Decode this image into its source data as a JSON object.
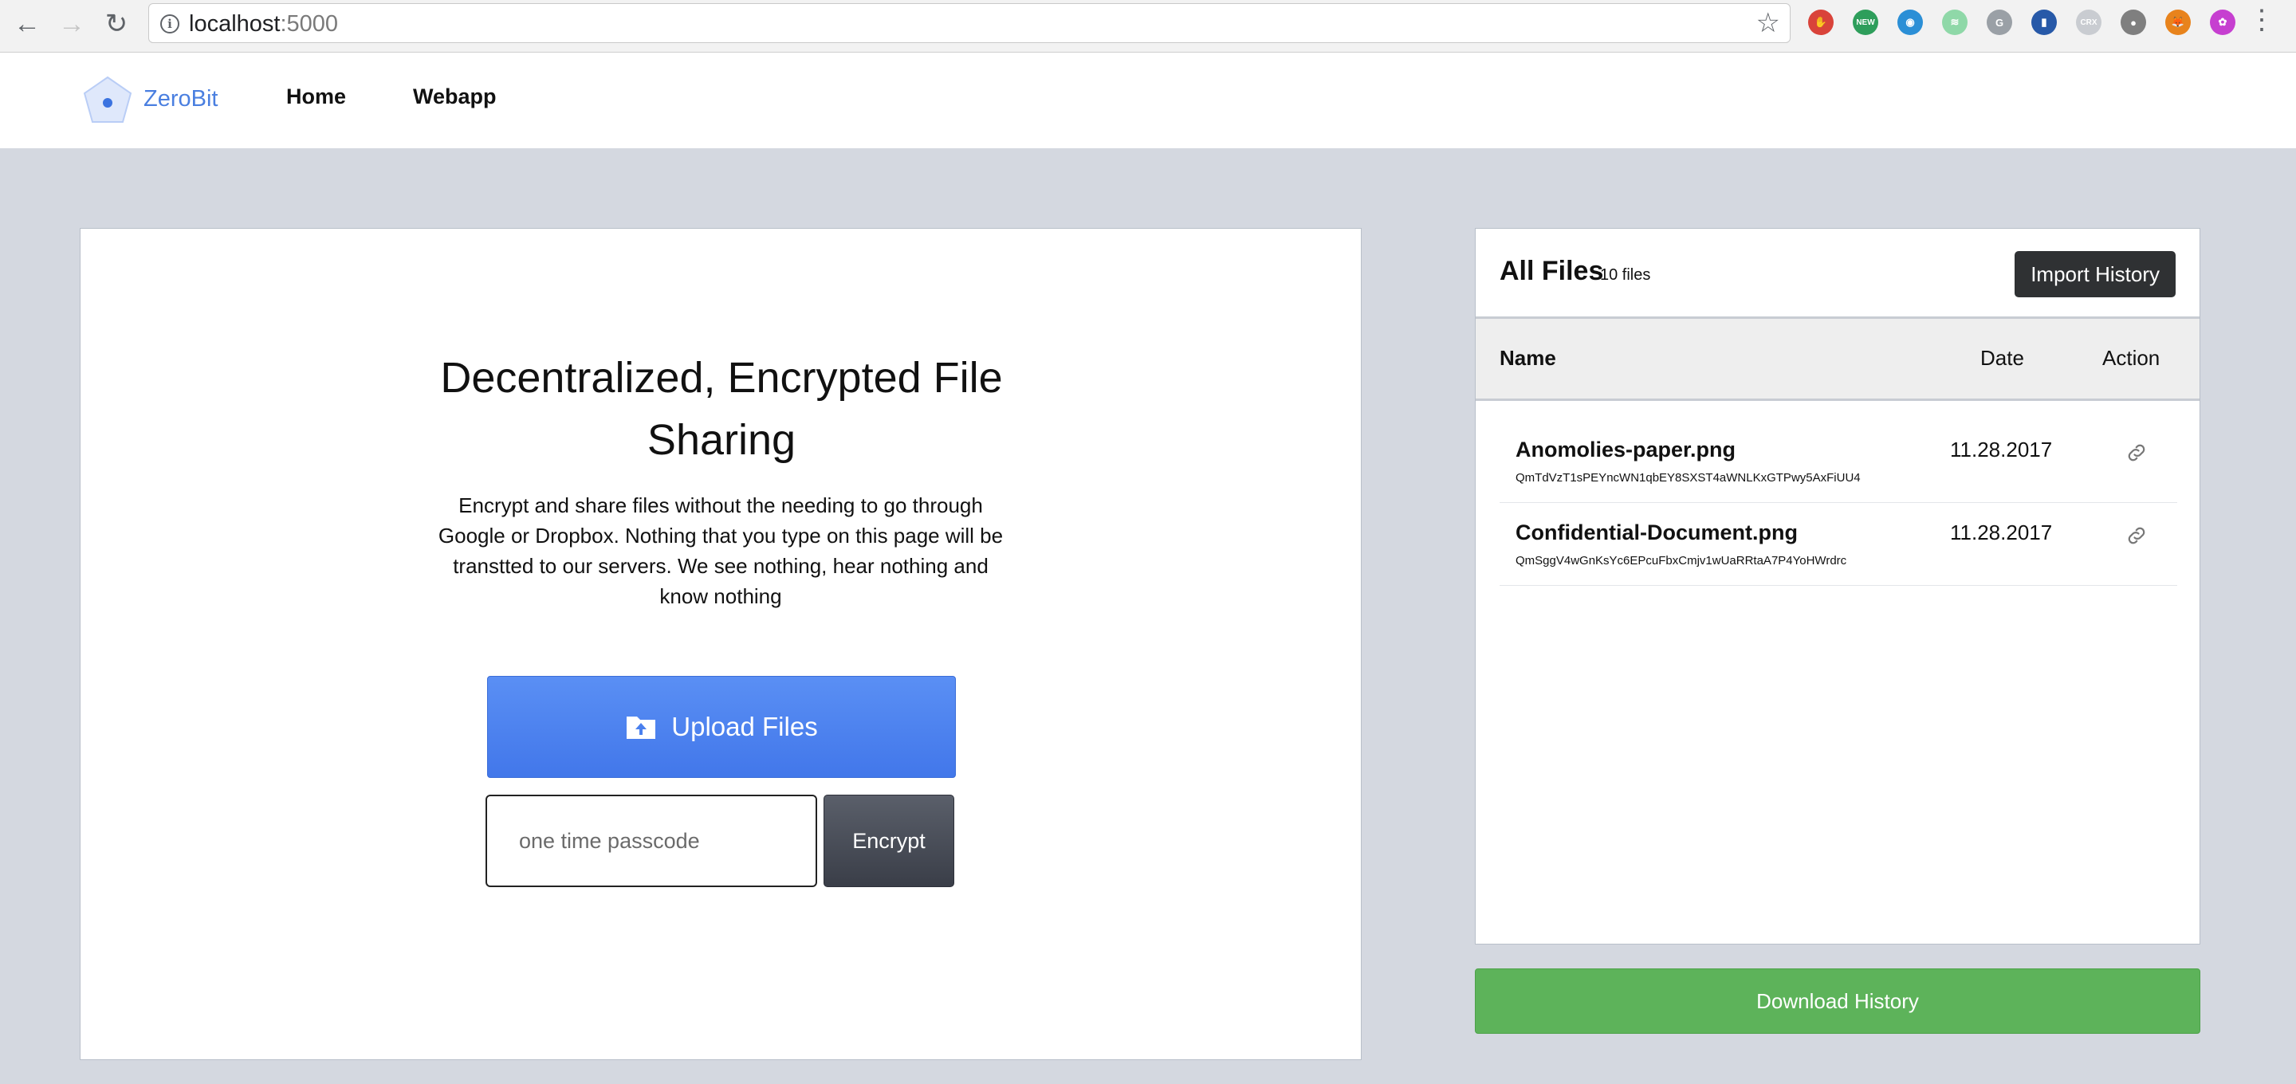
{
  "browser": {
    "url_host": "localhost",
    "url_port": ":5000",
    "back_icon": "back-arrow-icon",
    "forward_icon": "forward-arrow-icon",
    "reload_icon": "reload-icon",
    "bookmark_icon": "star-icon",
    "extensions": [
      {
        "name": "adblock-extension-icon",
        "color": "#d9433a",
        "label": "✋"
      },
      {
        "name": "new-badge-extension-icon",
        "color": "#2e9e5b",
        "label": "NEW"
      },
      {
        "name": "eye-extension-icon",
        "color": "#2b8fd6",
        "label": "◉"
      },
      {
        "name": "audio-extension-icon",
        "color": "#8fd8a8",
        "label": "≋"
      },
      {
        "name": "g-extension-icon",
        "color": "#9aa0a6",
        "label": "G"
      },
      {
        "name": "book-extension-icon",
        "color": "#2759a8",
        "label": "▮"
      },
      {
        "name": "crx-extension-icon",
        "color": "#c9ccd1",
        "label": "CRX"
      },
      {
        "name": "tomato-extension-icon",
        "color": "#7f7f7f",
        "label": "●"
      },
      {
        "name": "fox-extension-icon",
        "color": "#e8831c",
        "label": "🦊"
      },
      {
        "name": "color-wheel-extension-icon",
        "color": "#c63fd0",
        "label": "✿"
      }
    ]
  },
  "header": {
    "brand": "ZeroBit",
    "nav": [
      "Home",
      "Webapp"
    ]
  },
  "hero": {
    "title": "Decentralized, Encrypted File Sharing",
    "description": "Encrypt and share files without the needing to go through Google or Dropbox. Nothing that you type on this page will be transtted to our servers. We see nothing, hear nothing and know nothing",
    "upload_label": "Upload Files",
    "passcode_placeholder": "one time passcode",
    "encrypt_label": "Encrypt"
  },
  "files": {
    "title": "All Files",
    "count": "10 files",
    "import_label": "Import History",
    "columns": {
      "name": "Name",
      "date": "Date",
      "action": "Action"
    },
    "rows": [
      {
        "name": "Anomolies-paper.png",
        "hash": "QmTdVzT1sPEYncWN1qbEY8SXST4aWNLKxGTPwy5AxFiUU4",
        "date": "11.28.2017"
      },
      {
        "name": "Confidential-Document.png",
        "hash": "QmSggV4wGnKsYc6EPcuFbxCmjv1wUaRRtaA7P4YoHWrdrc",
        "date": "11.28.2017"
      }
    ],
    "download_label": "Download History"
  },
  "colors": {
    "accent": "#4a7fe0",
    "upload": "#4f86f0",
    "download": "#5db35a",
    "page_bg": "#d4d8e0"
  }
}
